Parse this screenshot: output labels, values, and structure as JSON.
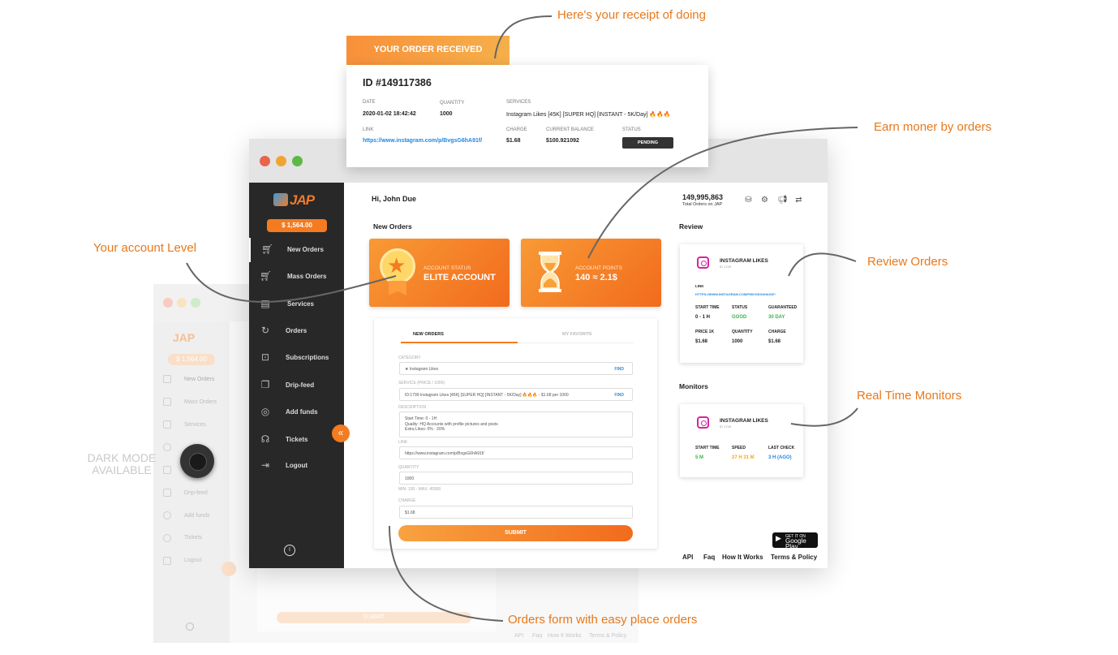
{
  "callouts": {
    "receipt": "Here's your receipt of doing",
    "earn": "Earn moner by orders",
    "level": "Your account Level",
    "review": "Review Orders",
    "monitors": "Real Time Monitors",
    "form": "Orders form with easy place orders",
    "dark_mode": "DARK MODE AVAILABLE"
  },
  "receipt": {
    "header": "YOUR ORDER RECEIVED",
    "id": "ID #149117386",
    "date_label": "DATE",
    "date": "2020-01-02 18:42:42",
    "quantity_label": "QUANTITY",
    "quantity": "1000",
    "services_label": "SERVICES",
    "services": "Instagram Likes [45K] [SUPER HQ] [INSTANT - 5K/Day] 🔥🔥🔥",
    "link_label": "LINK",
    "link": "https://www.instagram.com/p/BvgsG6hA91f/",
    "charge_label": "CHARGE",
    "charge": "$1.68",
    "balance_label": "CURRENT BALANCE",
    "balance": "$100.921092",
    "status_label": "STATUS",
    "status": "PENDING"
  },
  "window": {
    "traffic_colors": [
      "#e8654a",
      "#f1a531",
      "#5cb947"
    ]
  },
  "sidebar": {
    "logo": "JAP",
    "balance": "$ 1,564.00",
    "items": [
      {
        "label": "New Orders",
        "icon": "cart-icon"
      },
      {
        "label": "Mass Orders",
        "icon": "cart-icon"
      },
      {
        "label": "Services",
        "icon": "list-icon"
      },
      {
        "label": "Orders",
        "icon": "refresh-icon"
      },
      {
        "label": "Subscriptions",
        "icon": "inbox-icon"
      },
      {
        "label": "Drip-feed",
        "icon": "layers-icon"
      },
      {
        "label": "Add funds",
        "icon": "wallet-icon"
      },
      {
        "label": "Tickets",
        "icon": "headset-icon"
      },
      {
        "label": "Logout",
        "icon": "logout-icon"
      }
    ]
  },
  "header": {
    "greeting": "Hi, John Due",
    "total_orders": "149,995,863",
    "total_orders_label": "Total Orders on JAP"
  },
  "new_orders": {
    "title": "New Orders",
    "status_card": {
      "label": "ACCOUNT STATUS",
      "value": "ELITE ACCOUNT"
    },
    "points_card": {
      "label": "ACCOUNT POINTS",
      "value": "140 ≈ 2.1$"
    }
  },
  "form": {
    "tab_new": "NEW ORDERS",
    "tab_fav": "MY FAVORITE",
    "category_label": "CATEGORY",
    "category": "★ Instagram Likes",
    "find": "FIND",
    "service_label": "SERVICE (PRICE / 1000)",
    "service": "ID:1799 Instagram Likes [45K] [SUPER HQ] [INSTANT - 5K/Day] 🔥🔥🔥 - $1.68 per 1000",
    "description_label": "DESCRIPTION",
    "description_lines": [
      "Start Time: 0 - 1H",
      "Quality: HQ Accounts with profile pictures and posts",
      "Extra Likes: 0% - 20%"
    ],
    "link_label": "LINK",
    "link": "https://www.instagram.com/p/BvgsG6hA91f/",
    "quantity_label": "QUANTITY",
    "quantity": "1000",
    "minmax": "MIN: 100 - MAX: 45000",
    "charge_label": "CHARGE",
    "charge": "$1.68",
    "submit": "SUBMIT"
  },
  "review": {
    "title": "Review",
    "card_title": "INSTAGRAM LIKES",
    "card_sub": "ID 1749",
    "link_label": "LINK",
    "link": "HTTPS://WWW.INSTAGRAM.COM/P/BVGSG6HA91F/",
    "start_label": "START TIME",
    "start": "0 - 1 H",
    "status_label": "STATUS",
    "status": "GOOD",
    "guar_label": "GUARANTEED",
    "guar": "30 DAY",
    "price_label": "PRICE 1K",
    "price": "$1.68",
    "qty_label": "QUANTITY",
    "qty": "1000",
    "charge_label": "CHARGE",
    "charge": "$1.68"
  },
  "monitors": {
    "title": "Monitors",
    "card_title": "INSTAGRAM LIKES",
    "card_sub": "ID 1749",
    "start_label": "START TIME",
    "start": "5 M",
    "speed_label": "SPEED",
    "speed": "27 H 31 M",
    "check_label": "LAST CHECK",
    "check": "3 H (AGO)"
  },
  "footer": {
    "gplay_top": "GET IT ON",
    "gplay_bottom": "Google Play",
    "links": [
      "API",
      "Faq",
      "How It Works",
      "Terms & Policy"
    ]
  },
  "ghost": {
    "logo": "JAP",
    "balance": "$ 1,564.00",
    "items": [
      "New Orders",
      "Mass Orders",
      "Services",
      "",
      "",
      "Drip-feed",
      "Add funds",
      "Tickets",
      "Logout"
    ],
    "submit": "SUBMIT",
    "footer": [
      "API",
      "Faq",
      "How It Works",
      "Terms & Policy"
    ]
  },
  "colors": {
    "accent": "#f47b20",
    "sidebar": "#282828",
    "callout": "#e8781a"
  }
}
